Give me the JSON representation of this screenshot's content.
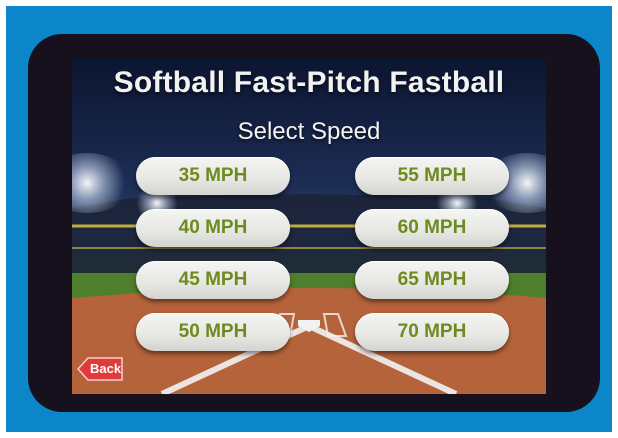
{
  "header": {
    "title": "Softball Fast-Pitch Fastball",
    "subtitle": "Select Speed"
  },
  "speeds": {
    "left": [
      "35 MPH",
      "40 MPH",
      "45 MPH",
      "50 MPH"
    ],
    "right": [
      "55 MPH",
      "60 MPH",
      "65 MPH",
      "70 MPH"
    ]
  },
  "nav": {
    "back_label": "Back"
  },
  "colors": {
    "frame": "#0b86c8",
    "button_text": "#6f8a1e",
    "back_button": "#e03a3a"
  }
}
